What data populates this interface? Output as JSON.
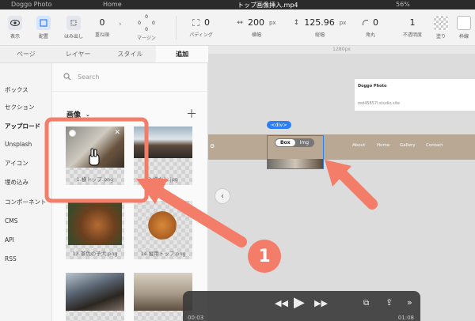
{
  "window": {
    "left_title": "Doggo Photo",
    "home_tab": "Home",
    "file_title": "トップ画像挿入.mp4",
    "zoom": "56%"
  },
  "toolbar": {
    "display_label": "表示",
    "layout_label": "配置",
    "overflow_label": "はみ出し",
    "order_value": "0",
    "order_label": "重ね順",
    "margin_top": "0",
    "margin_left": "0",
    "margin_right": "0",
    "margin_bottom": "0",
    "margin_label": "マージン",
    "padding_value": "0",
    "padding_label": "パディング",
    "width_value": "200",
    "width_unit": "px",
    "width_label": "横幅",
    "height_value": "125.96",
    "height_unit": "px",
    "height_label": "縦幅",
    "radius_value": "0",
    "radius_label": "角丸",
    "opacity_value": "1",
    "opacity_label": "不透明度",
    "fill_label": "塗り",
    "border_label": "枠線"
  },
  "panel": {
    "tabs": [
      {
        "label": "ページ"
      },
      {
        "label": "レイヤー"
      },
      {
        "label": "スタイル"
      },
      {
        "label": "追加"
      }
    ],
    "nav": [
      {
        "label": "ボックス"
      },
      {
        "label": "セクション"
      },
      {
        "label": "アップロード"
      },
      {
        "label": "Unsplash"
      },
      {
        "label": "アイコン"
      },
      {
        "label": "埋め込み"
      },
      {
        "label": "コンポーネント"
      },
      {
        "label": "CMS"
      },
      {
        "label": "API"
      },
      {
        "label": "RSS"
      }
    ],
    "search_placeholder": "Search",
    "section_title": "画像",
    "images": [
      {
        "caption": "1.横トップ.png"
      },
      {
        "caption": "2.横なし.jpg"
      },
      {
        "caption": "13.茶色の子犬.png"
      },
      {
        "caption": "14.縦用トップ.png"
      },
      {
        "caption": ""
      },
      {
        "caption": ""
      }
    ]
  },
  "canvas": {
    "ruler_label": "1280px",
    "card_title": "Doggo Photo",
    "card_url": "red45857l.studio.site",
    "div_badge": "<div>",
    "seg_box": "Box",
    "seg_img": "Img",
    "nav_about": "About",
    "nav_home": "Home",
    "nav_gallery": "Gallery",
    "nav_contact": "Contact"
  },
  "video": {
    "current_time": "00:03",
    "end_time": "01:08"
  },
  "annotation": {
    "step": "1"
  },
  "colors": {
    "accent_blue": "#2d7ff9",
    "annotation_coral": "#f47d6a"
  }
}
